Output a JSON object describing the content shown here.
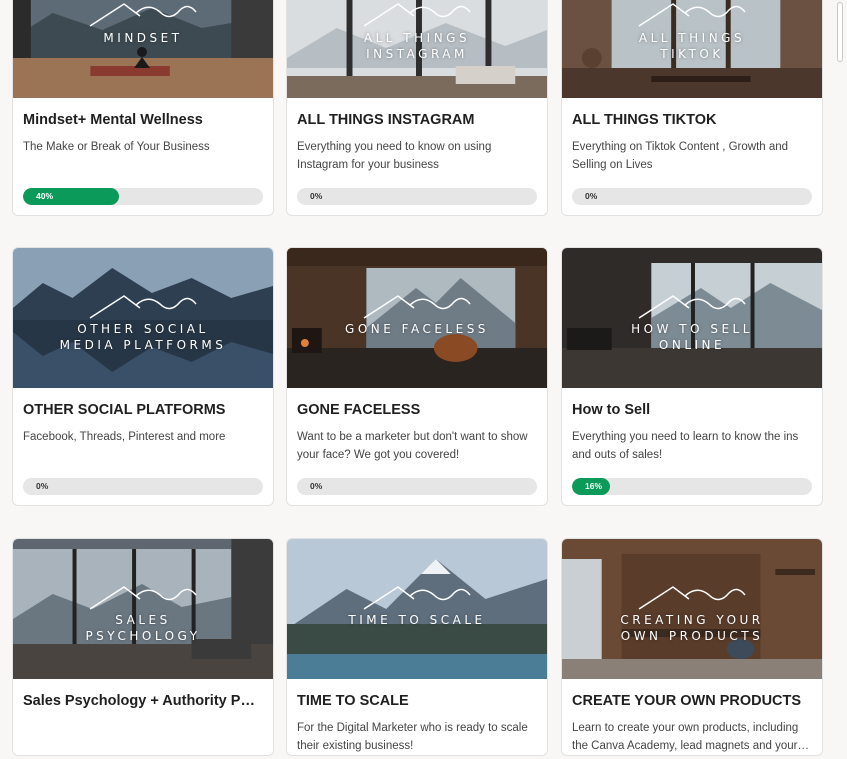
{
  "courses": [
    {
      "thumb_title": "MINDSET",
      "name": "Mindset+ Mental Wellness",
      "desc": "The Make or Break of Your Business",
      "progress": 0.4,
      "progress_label": "40%"
    },
    {
      "thumb_title": "ALL THINGS\nINSTAGRAM",
      "name": "ALL THINGS INSTAGRAM",
      "desc": "Everything you need to know on using Instagram for your business",
      "progress": 0,
      "progress_label": "0%"
    },
    {
      "thumb_title": "ALL THINGS\nTIKTOK",
      "name": "ALL THINGS TIKTOK",
      "desc": "Everything on Tiktok Content , Growth and Selling on Lives",
      "progress": 0,
      "progress_label": "0%"
    },
    {
      "thumb_title": "OTHER SOCIAL\nMEDIA PLATFORMS",
      "name": "OTHER SOCIAL PLATFORMS",
      "desc": "Facebook, Threads, Pinterest and more",
      "progress": 0,
      "progress_label": "0%"
    },
    {
      "thumb_title": "GONE FACELESS",
      "name": "GONE FACELESS",
      "desc": "Want to be a marketer but don't want to show your face? We got you covered!",
      "progress": 0,
      "progress_label": "0%"
    },
    {
      "thumb_title": "HOW TO SELL\nONLINE",
      "name": "How to Sell",
      "desc": "Everything you need to learn to know the ins and outs of sales!",
      "progress": 0.16,
      "progress_label": "16%"
    },
    {
      "thumb_title": "SALES\nPSYCHOLOGY",
      "name": "Sales Psychology + Authority Positioning",
      "desc": "",
      "progress": null,
      "progress_label": ""
    },
    {
      "thumb_title": "TIME TO SCALE",
      "name": "TIME TO SCALE",
      "desc": "For the Digital Marketer who is ready to scale their existing business!",
      "progress": null,
      "progress_label": ""
    },
    {
      "thumb_title": "CREATING YOUR\nOWN PRODUCTS",
      "name": "CREATE YOUR OWN PRODUCTS",
      "desc": "Learn to create your own products, including the Canva Academy, lead magnets and your own digital products",
      "progress": null,
      "progress_label": ""
    }
  ],
  "colors": {
    "progress_fill": "#0b9a5a",
    "progress_track": "#e6e6e6"
  }
}
